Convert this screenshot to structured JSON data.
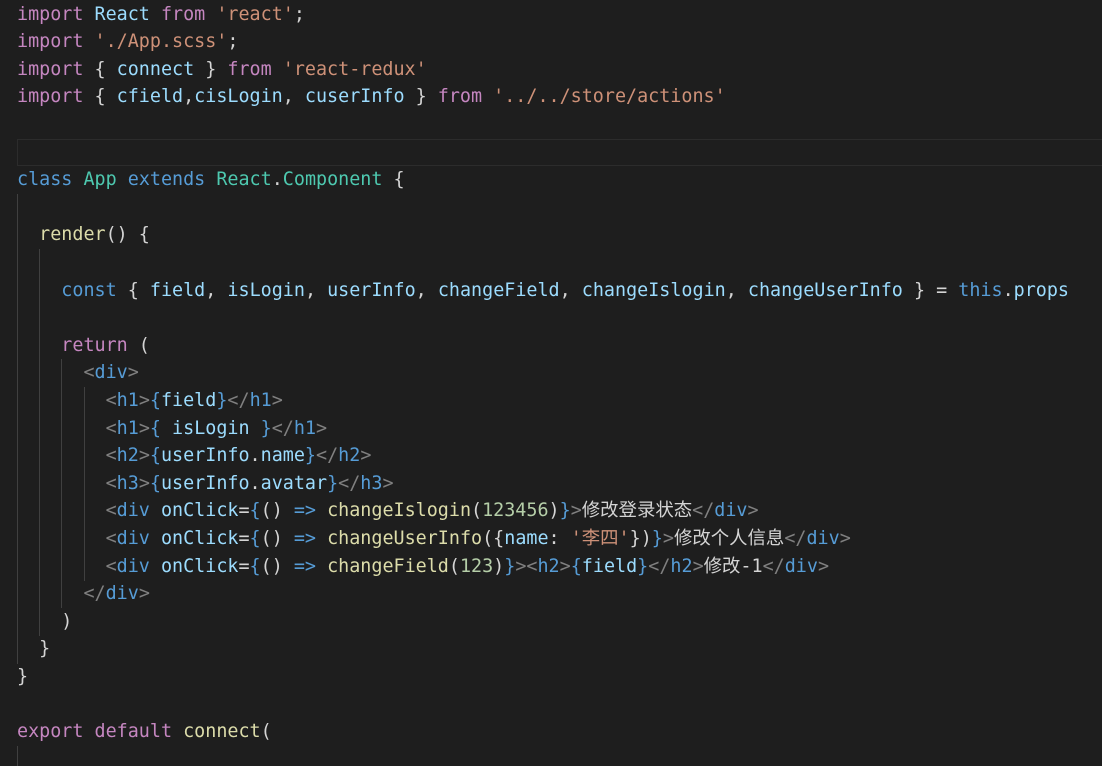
{
  "editor": {
    "theme": {
      "background": "#1e1e1e",
      "default": "#d4d4d4",
      "keyword_control": "#c586c0",
      "keyword": "#569cd6",
      "variable": "#9cdcfe",
      "type": "#4ec9b0",
      "string": "#ce9178",
      "function": "#dcdcaa",
      "number": "#b5cea8",
      "tag_bracket": "#808080"
    },
    "lines": [
      {
        "tokens": [
          [
            "k-purple",
            "import"
          ],
          [
            "k-punc",
            " "
          ],
          [
            "k-light",
            "React"
          ],
          [
            "k-punc",
            " "
          ],
          [
            "k-purple",
            "from"
          ],
          [
            "k-punc",
            " "
          ],
          [
            "k-str",
            "'react'"
          ],
          [
            "k-punc",
            ";"
          ]
        ]
      },
      {
        "tokens": [
          [
            "k-purple",
            "import"
          ],
          [
            "k-punc",
            " "
          ],
          [
            "k-str",
            "'./App.scss'"
          ],
          [
            "k-punc",
            ";"
          ]
        ]
      },
      {
        "tokens": [
          [
            "k-purple",
            "import"
          ],
          [
            "k-punc",
            " { "
          ],
          [
            "k-light",
            "connect"
          ],
          [
            "k-punc",
            " } "
          ],
          [
            "k-purple",
            "from"
          ],
          [
            "k-punc",
            " "
          ],
          [
            "k-str",
            "'react-redux'"
          ]
        ]
      },
      {
        "tokens": [
          [
            "k-purple",
            "import"
          ],
          [
            "k-punc",
            " { "
          ],
          [
            "k-light",
            "cfield"
          ],
          [
            "k-punc",
            ","
          ],
          [
            "k-light",
            "cisLogin"
          ],
          [
            "k-punc",
            ", "
          ],
          [
            "k-light",
            "cuserInfo"
          ],
          [
            "k-punc",
            " } "
          ],
          [
            "k-purple",
            "from"
          ],
          [
            "k-punc",
            " "
          ],
          [
            "k-str",
            "'../../store/actions'"
          ]
        ]
      },
      {
        "tokens": []
      },
      {
        "tokens": []
      },
      {
        "tokens": [
          [
            "k-blue",
            "class"
          ],
          [
            "k-punc",
            " "
          ],
          [
            "k-teal",
            "App"
          ],
          [
            "k-punc",
            " "
          ],
          [
            "k-blue",
            "extends"
          ],
          [
            "k-punc",
            " "
          ],
          [
            "k-teal",
            "React"
          ],
          [
            "k-punc",
            "."
          ],
          [
            "k-teal",
            "Component"
          ],
          [
            "k-punc",
            " {"
          ]
        ]
      },
      {
        "tokens": []
      },
      {
        "tokens": [
          [
            "k-punc",
            "  "
          ],
          [
            "k-yellow",
            "render"
          ],
          [
            "k-punc",
            "() {"
          ]
        ]
      },
      {
        "tokens": []
      },
      {
        "tokens": [
          [
            "k-punc",
            "    "
          ],
          [
            "k-blue",
            "const"
          ],
          [
            "k-punc",
            " { "
          ],
          [
            "k-light",
            "field"
          ],
          [
            "k-punc",
            ", "
          ],
          [
            "k-light",
            "isLogin"
          ],
          [
            "k-punc",
            ", "
          ],
          [
            "k-light",
            "userInfo"
          ],
          [
            "k-punc",
            ", "
          ],
          [
            "k-light",
            "changeField"
          ],
          [
            "k-punc",
            ", "
          ],
          [
            "k-light",
            "changeIslogin"
          ],
          [
            "k-punc",
            ", "
          ],
          [
            "k-light",
            "changeUserInfo"
          ],
          [
            "k-punc",
            " } = "
          ],
          [
            "k-blue",
            "this"
          ],
          [
            "k-punc",
            "."
          ],
          [
            "k-light",
            "props"
          ]
        ]
      },
      {
        "tokens": []
      },
      {
        "tokens": [
          [
            "k-punc",
            "    "
          ],
          [
            "k-purple",
            "return"
          ],
          [
            "k-punc",
            " ("
          ]
        ]
      },
      {
        "tokens": [
          [
            "k-punc",
            "      "
          ],
          [
            "k-tag",
            "<"
          ],
          [
            "k-blue",
            "div"
          ],
          [
            "k-tag",
            ">"
          ]
        ]
      },
      {
        "tokens": [
          [
            "k-punc",
            "        "
          ],
          [
            "k-tag",
            "<"
          ],
          [
            "k-blue",
            "h1"
          ],
          [
            "k-tag",
            ">"
          ],
          [
            "k-blue",
            "{"
          ],
          [
            "k-light",
            "field"
          ],
          [
            "k-blue",
            "}"
          ],
          [
            "k-tag",
            "</"
          ],
          [
            "k-blue",
            "h1"
          ],
          [
            "k-tag",
            ">"
          ]
        ]
      },
      {
        "tokens": [
          [
            "k-punc",
            "        "
          ],
          [
            "k-tag",
            "<"
          ],
          [
            "k-blue",
            "h1"
          ],
          [
            "k-tag",
            ">"
          ],
          [
            "k-blue",
            "{"
          ],
          [
            "k-punc",
            " "
          ],
          [
            "k-light",
            "isLogin"
          ],
          [
            "k-punc",
            " "
          ],
          [
            "k-blue",
            "}"
          ],
          [
            "k-tag",
            "</"
          ],
          [
            "k-blue",
            "h1"
          ],
          [
            "k-tag",
            ">"
          ]
        ]
      },
      {
        "tokens": [
          [
            "k-punc",
            "        "
          ],
          [
            "k-tag",
            "<"
          ],
          [
            "k-blue",
            "h2"
          ],
          [
            "k-tag",
            ">"
          ],
          [
            "k-blue",
            "{"
          ],
          [
            "k-light",
            "userInfo"
          ],
          [
            "k-punc",
            "."
          ],
          [
            "k-light",
            "name"
          ],
          [
            "k-blue",
            "}"
          ],
          [
            "k-tag",
            "</"
          ],
          [
            "k-blue",
            "h2"
          ],
          [
            "k-tag",
            ">"
          ]
        ]
      },
      {
        "tokens": [
          [
            "k-punc",
            "        "
          ],
          [
            "k-tag",
            "<"
          ],
          [
            "k-blue",
            "h3"
          ],
          [
            "k-tag",
            ">"
          ],
          [
            "k-blue",
            "{"
          ],
          [
            "k-light",
            "userInfo"
          ],
          [
            "k-punc",
            "."
          ],
          [
            "k-light",
            "avatar"
          ],
          [
            "k-blue",
            "}"
          ],
          [
            "k-tag",
            "</"
          ],
          [
            "k-blue",
            "h3"
          ],
          [
            "k-tag",
            ">"
          ]
        ]
      },
      {
        "tokens": [
          [
            "k-punc",
            "        "
          ],
          [
            "k-tag",
            "<"
          ],
          [
            "k-blue",
            "div"
          ],
          [
            "k-punc",
            " "
          ],
          [
            "k-light",
            "onClick"
          ],
          [
            "k-punc",
            "="
          ],
          [
            "k-blue",
            "{"
          ],
          [
            "k-punc",
            "() "
          ],
          [
            "k-blue",
            "=>"
          ],
          [
            "k-punc",
            " "
          ],
          [
            "k-yellow",
            "changeIslogin"
          ],
          [
            "k-punc",
            "("
          ],
          [
            "k-num",
            "123456"
          ],
          [
            "k-punc",
            ")"
          ],
          [
            "k-blue",
            "}"
          ],
          [
            "k-tag",
            ">"
          ],
          [
            "k-punc",
            "修改登录状态"
          ],
          [
            "k-tag",
            "</"
          ],
          [
            "k-blue",
            "div"
          ],
          [
            "k-tag",
            ">"
          ]
        ]
      },
      {
        "tokens": [
          [
            "k-punc",
            "        "
          ],
          [
            "k-tag",
            "<"
          ],
          [
            "k-blue",
            "div"
          ],
          [
            "k-punc",
            " "
          ],
          [
            "k-light",
            "onClick"
          ],
          [
            "k-punc",
            "="
          ],
          [
            "k-blue",
            "{"
          ],
          [
            "k-punc",
            "() "
          ],
          [
            "k-blue",
            "=>"
          ],
          [
            "k-punc",
            " "
          ],
          [
            "k-yellow",
            "changeUserInfo"
          ],
          [
            "k-punc",
            "({"
          ],
          [
            "k-light",
            "name"
          ],
          [
            "k-punc",
            ": "
          ],
          [
            "k-str",
            "'李四'"
          ],
          [
            "k-punc",
            "})"
          ],
          [
            "k-blue",
            "}"
          ],
          [
            "k-tag",
            ">"
          ],
          [
            "k-punc",
            "修改个人信息"
          ],
          [
            "k-tag",
            "</"
          ],
          [
            "k-blue",
            "div"
          ],
          [
            "k-tag",
            ">"
          ]
        ]
      },
      {
        "tokens": [
          [
            "k-punc",
            "        "
          ],
          [
            "k-tag",
            "<"
          ],
          [
            "k-blue",
            "div"
          ],
          [
            "k-punc",
            " "
          ],
          [
            "k-light",
            "onClick"
          ],
          [
            "k-punc",
            "="
          ],
          [
            "k-blue",
            "{"
          ],
          [
            "k-punc",
            "() "
          ],
          [
            "k-blue",
            "=>"
          ],
          [
            "k-punc",
            " "
          ],
          [
            "k-yellow",
            "changeField"
          ],
          [
            "k-punc",
            "("
          ],
          [
            "k-num",
            "123"
          ],
          [
            "k-punc",
            ")"
          ],
          [
            "k-blue",
            "}"
          ],
          [
            "k-tag",
            "><"
          ],
          [
            "k-blue",
            "h2"
          ],
          [
            "k-tag",
            ">"
          ],
          [
            "k-blue",
            "{"
          ],
          [
            "k-light",
            "field"
          ],
          [
            "k-blue",
            "}"
          ],
          [
            "k-tag",
            "</"
          ],
          [
            "k-blue",
            "h2"
          ],
          [
            "k-tag",
            ">"
          ],
          [
            "k-punc",
            "修改-1"
          ],
          [
            "k-tag",
            "</"
          ],
          [
            "k-blue",
            "div"
          ],
          [
            "k-tag",
            ">"
          ]
        ]
      },
      {
        "tokens": [
          [
            "k-punc",
            "      "
          ],
          [
            "k-tag",
            "</"
          ],
          [
            "k-blue",
            "div"
          ],
          [
            "k-tag",
            ">"
          ]
        ]
      },
      {
        "tokens": [
          [
            "k-punc",
            "    )"
          ]
        ]
      },
      {
        "tokens": [
          [
            "k-punc",
            "  }"
          ]
        ]
      },
      {
        "tokens": [
          [
            "k-punc",
            "}"
          ]
        ]
      },
      {
        "tokens": []
      },
      {
        "tokens": [
          [
            "k-purple",
            "export"
          ],
          [
            "k-punc",
            " "
          ],
          [
            "k-purple",
            "default"
          ],
          [
            "k-punc",
            " "
          ],
          [
            "k-yellow",
            "connect"
          ],
          [
            "k-punc",
            "("
          ]
        ]
      }
    ]
  }
}
